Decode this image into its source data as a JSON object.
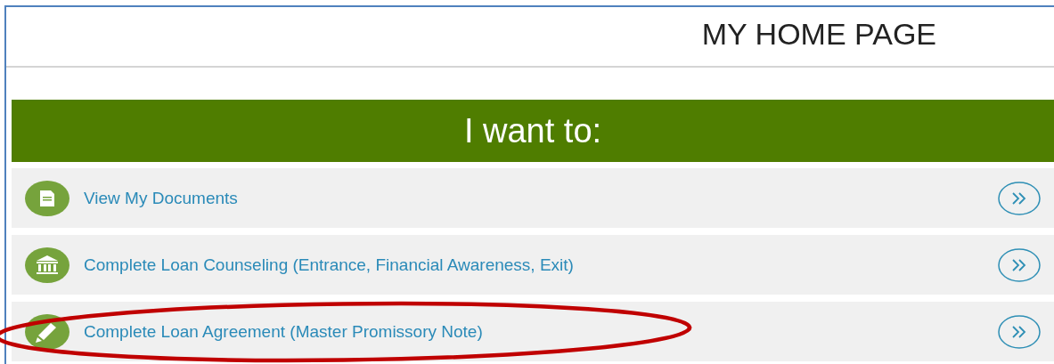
{
  "page_title": "MY HOME PAGE",
  "banner": "I want to:",
  "actions": [
    {
      "label": "View My Documents",
      "highlighted": false
    },
    {
      "label": "Complete Loan Counseling (Entrance, Financial Awareness, Exit)",
      "highlighted": false
    },
    {
      "label": "Complete Loan Agreement (Master Promissory Note)",
      "highlighted": true
    }
  ]
}
